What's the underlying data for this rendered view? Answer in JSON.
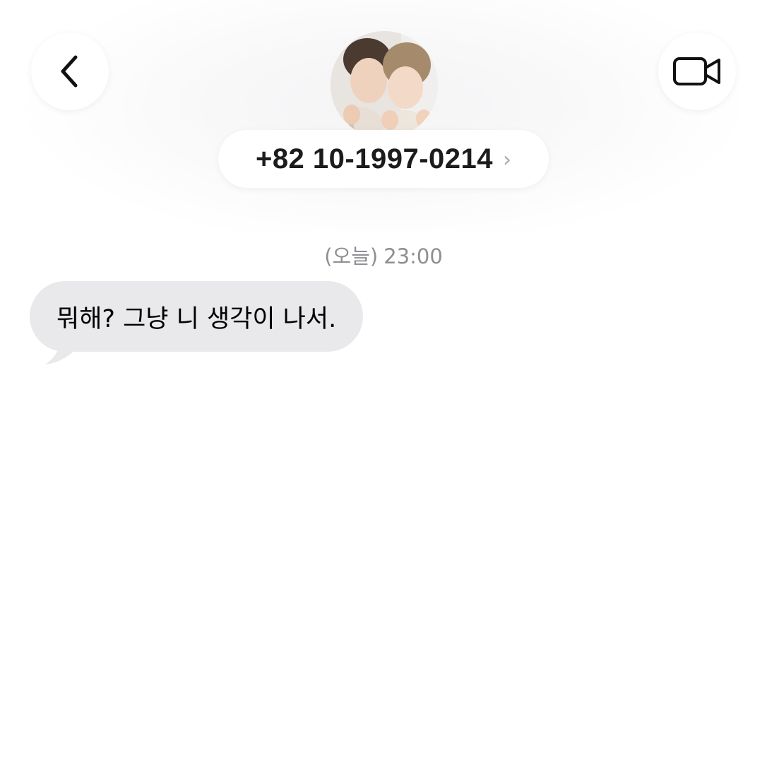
{
  "header": {
    "back_icon": "chevron-left-icon",
    "video_icon": "video-camera-icon",
    "contact_name": "+82 10-1997-0214",
    "contact_chevron": "›"
  },
  "conversation": {
    "timestamp_day": "(오늘)",
    "timestamp_time": "23:00",
    "messages": [
      {
        "direction": "incoming",
        "text": "뭐해? 그냥 니 생각이 나서."
      }
    ]
  },
  "colors": {
    "incoming_bubble": "#e9e9eb",
    "timestamp_text": "#8e8e93",
    "contact_text": "#1c1c1e"
  }
}
